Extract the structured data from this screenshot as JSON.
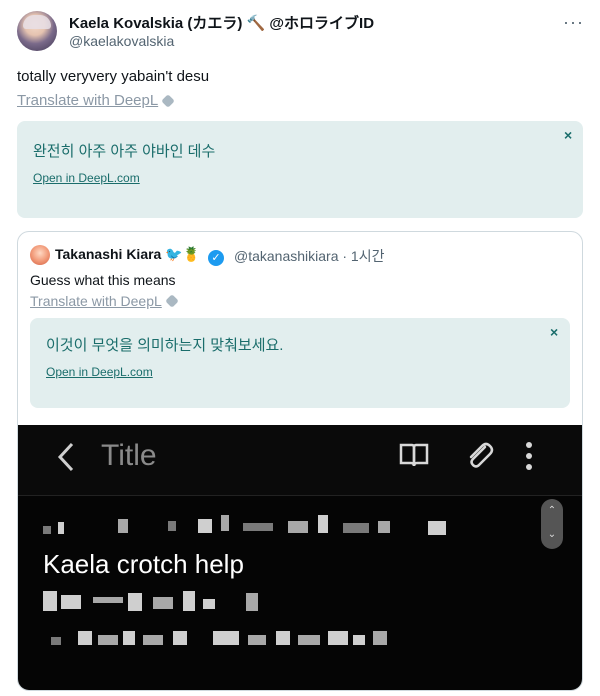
{
  "tweet": {
    "author_name": "Kaela Kovalskia",
    "author_extra": "(カエラ) 🔨 @ホロライブID",
    "handle": "@kaelakovalskia",
    "more_glyph": "···",
    "text": "totally veryvery yabain't desu",
    "translate_label": "Translate with DeepL"
  },
  "deepl_main": {
    "translation": "완전히 아주 아주 야바인 데수",
    "open_link": "Open in DeepL.com",
    "close": "×"
  },
  "quote": {
    "author_name": "Takanashi Kiara",
    "author_emoji": "🐦🍍",
    "verified_glyph": "✓",
    "handle_time": "@takanashikiara · 1시간",
    "text": "Guess what this means",
    "translate_label": "Translate with DeepL",
    "deepl": {
      "translation": "이것이 무엇을 의미하는지 맞춰보세요.",
      "open_link": "Open in DeepL.com",
      "close": "×"
    },
    "media": {
      "screen_title": "Title",
      "visible_line": "Kaela crotch help",
      "scroll_up": "⌃",
      "scroll_down": "⌄"
    }
  },
  "colors": {
    "deepl_bg": "#e2eeee",
    "deepl_text": "#1a6d6b",
    "link_gray": "#8b98a5",
    "verified_blue": "#1d9bf0"
  }
}
